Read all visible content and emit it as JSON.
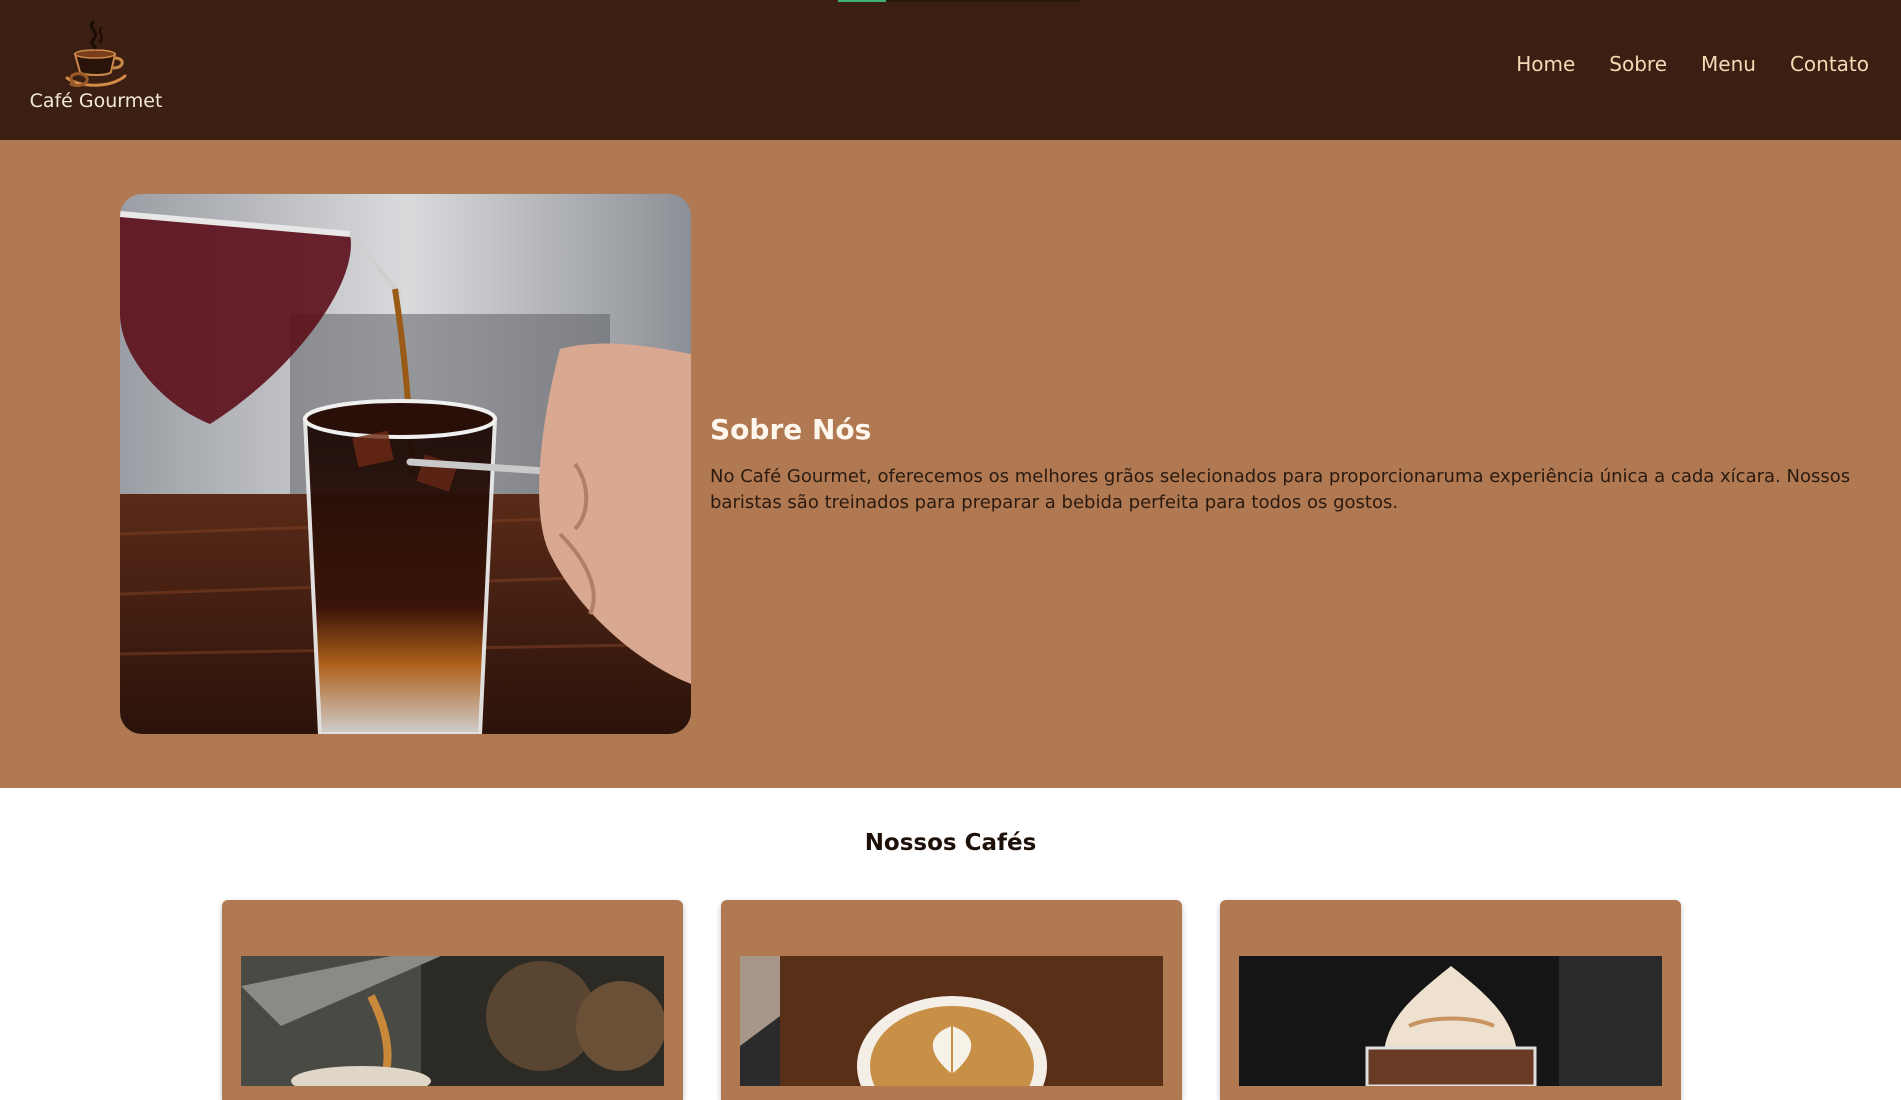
{
  "header": {
    "brand_name": "Café Gourmet",
    "nav": [
      "Home",
      "Sobre",
      "Menu",
      "Contato"
    ]
  },
  "about": {
    "title": "Sobre Nós",
    "body": "No Café Gourmet, oferecemos os melhores grãos selecionados para proporcionaruma experiência única a cada xícara. Nossos baristas são treinados para preparar a bebida perfeita para todos os gostos."
  },
  "coffees": {
    "title": "Nossos Cafés"
  },
  "colors": {
    "header_bg": "#3a1f12",
    "section_bg": "#b07952",
    "nav_text": "#f3d9b4"
  }
}
